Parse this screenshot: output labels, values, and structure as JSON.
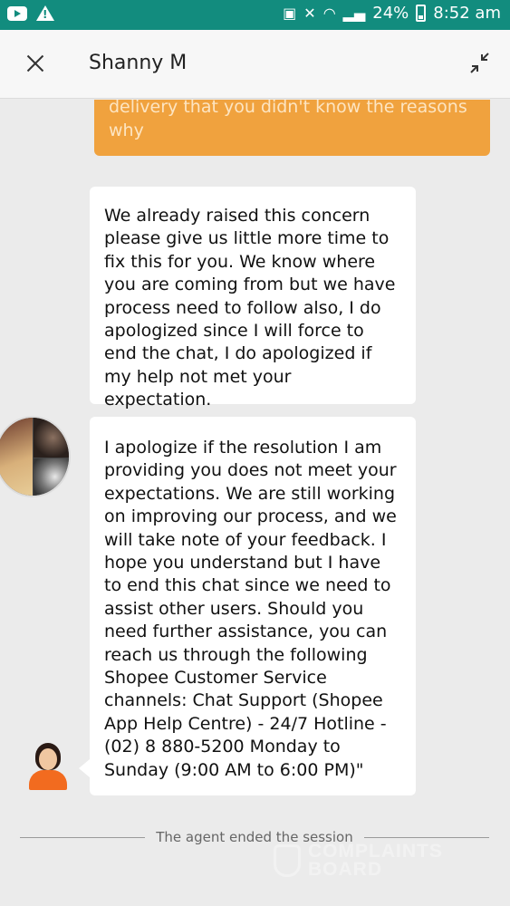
{
  "status_bar": {
    "battery": "24%",
    "time": "8:52 am"
  },
  "header": {
    "title": "Shanny M"
  },
  "messages": [
    {
      "from": "user",
      "text": "delivery that you didn't know the reasons why"
    },
    {
      "from": "agent",
      "text": "We already raised this concern please give us little more time to fix this for you. We know where you are coming from but we have process need to follow also, I do apologized since I will force to end the chat, I do apologized if my help not met your expectation."
    },
    {
      "from": "agent",
      "text": "I apologize if the resolution I am providing you does not meet your expectations. We are still working on improving our process, and we will take note of your feedback. I hope you understand but I have to end this chat since we need to assist other users. Should you need further assistance, you can reach us through the following Shopee Customer Service channels: Chat Support (Shopee App Help Centre) - 24/7 Hotline - (02) 8 880-5200 Monday to Sunday (9:00 AM to 6:00 PM)\""
    }
  ],
  "session_notice": "The agent ended the session",
  "watermark": {
    "line1": "COMPLAINTS",
    "line2": "BOARD"
  },
  "colors": {
    "status_bar": "#128c7e",
    "user_bubble": "#f0a23e",
    "agent_bubble": "#ffffff",
    "background": "#ebebeb"
  }
}
